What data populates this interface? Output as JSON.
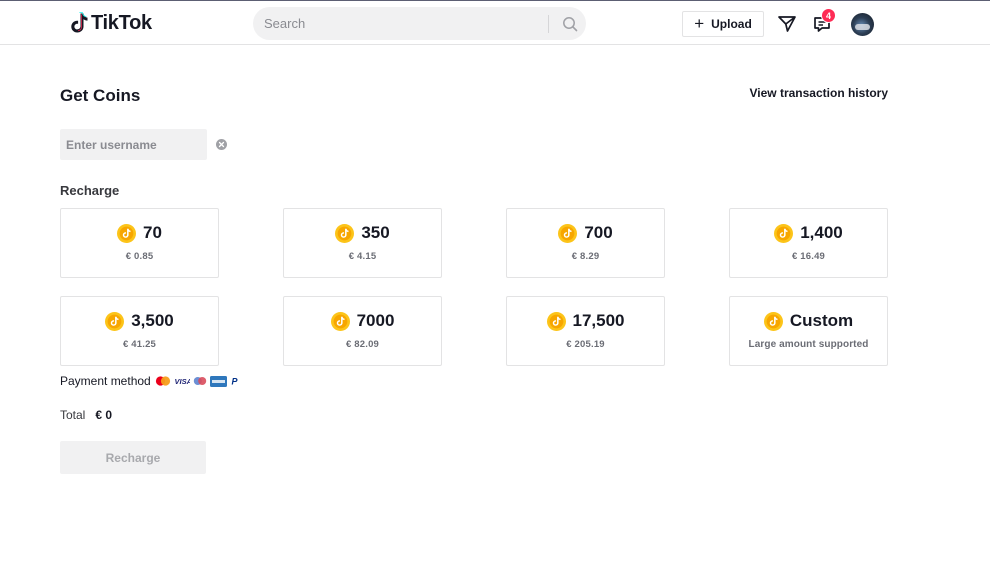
{
  "header": {
    "brand": "TikTok",
    "search_placeholder": "Search",
    "upload_label": "Upload",
    "inbox_badge": "4"
  },
  "main": {
    "title": "Get Coins",
    "history_link": "View transaction history",
    "username_placeholder": "Enter username",
    "recharge_section_label": "Recharge",
    "packages": [
      {
        "amount": "70",
        "price": "€ 0.85"
      },
      {
        "amount": "350",
        "price": "€ 4.15"
      },
      {
        "amount": "700",
        "price": "€ 8.29"
      },
      {
        "amount": "1,400",
        "price": "€ 16.49"
      },
      {
        "amount": "3,500",
        "price": "€ 41.25"
      },
      {
        "amount": "7000",
        "price": "€ 82.09"
      },
      {
        "amount": "17,500",
        "price": "€ 205.19"
      },
      {
        "amount": "Custom",
        "price": "Large amount supported"
      }
    ],
    "payment_label": "Payment method",
    "payment_icons": [
      "mastercard-icon",
      "visa-icon",
      "maestro-icon",
      "amex-icon",
      "paypal-icon"
    ],
    "total_label": "Total",
    "total_value": "€ 0",
    "recharge_button": "Recharge"
  },
  "colors": {
    "accent": "#fe2c55",
    "coin_outer": "#fcc419",
    "coin_inner": "#f7a600",
    "disabled_button_bg": "#f1f1f2"
  }
}
